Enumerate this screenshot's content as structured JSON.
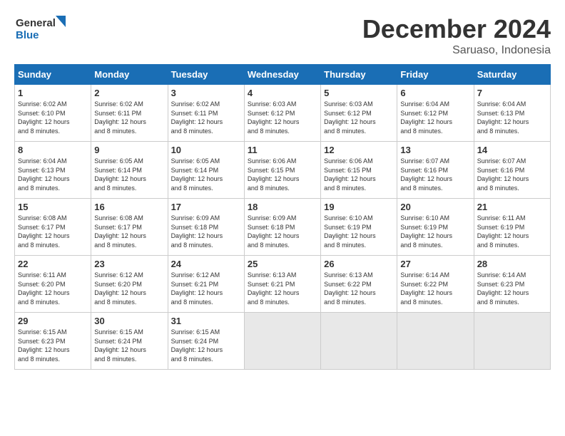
{
  "logo": {
    "line1": "General",
    "line2": "Blue"
  },
  "title": "December 2024",
  "subtitle": "Saruaso, Indonesia",
  "days_header": [
    "Sunday",
    "Monday",
    "Tuesday",
    "Wednesday",
    "Thursday",
    "Friday",
    "Saturday"
  ],
  "weeks": [
    [
      {
        "day": "1",
        "info": "Sunrise: 6:02 AM\nSunset: 6:10 PM\nDaylight: 12 hours\nand 8 minutes."
      },
      {
        "day": "2",
        "info": "Sunrise: 6:02 AM\nSunset: 6:11 PM\nDaylight: 12 hours\nand 8 minutes."
      },
      {
        "day": "3",
        "info": "Sunrise: 6:02 AM\nSunset: 6:11 PM\nDaylight: 12 hours\nand 8 minutes."
      },
      {
        "day": "4",
        "info": "Sunrise: 6:03 AM\nSunset: 6:12 PM\nDaylight: 12 hours\nand 8 minutes."
      },
      {
        "day": "5",
        "info": "Sunrise: 6:03 AM\nSunset: 6:12 PM\nDaylight: 12 hours\nand 8 minutes."
      },
      {
        "day": "6",
        "info": "Sunrise: 6:04 AM\nSunset: 6:12 PM\nDaylight: 12 hours\nand 8 minutes."
      },
      {
        "day": "7",
        "info": "Sunrise: 6:04 AM\nSunset: 6:13 PM\nDaylight: 12 hours\nand 8 minutes."
      }
    ],
    [
      {
        "day": "8",
        "info": "Sunrise: 6:04 AM\nSunset: 6:13 PM\nDaylight: 12 hours\nand 8 minutes."
      },
      {
        "day": "9",
        "info": "Sunrise: 6:05 AM\nSunset: 6:14 PM\nDaylight: 12 hours\nand 8 minutes."
      },
      {
        "day": "10",
        "info": "Sunrise: 6:05 AM\nSunset: 6:14 PM\nDaylight: 12 hours\nand 8 minutes."
      },
      {
        "day": "11",
        "info": "Sunrise: 6:06 AM\nSunset: 6:15 PM\nDaylight: 12 hours\nand 8 minutes."
      },
      {
        "day": "12",
        "info": "Sunrise: 6:06 AM\nSunset: 6:15 PM\nDaylight: 12 hours\nand 8 minutes."
      },
      {
        "day": "13",
        "info": "Sunrise: 6:07 AM\nSunset: 6:16 PM\nDaylight: 12 hours\nand 8 minutes."
      },
      {
        "day": "14",
        "info": "Sunrise: 6:07 AM\nSunset: 6:16 PM\nDaylight: 12 hours\nand 8 minutes."
      }
    ],
    [
      {
        "day": "15",
        "info": "Sunrise: 6:08 AM\nSunset: 6:17 PM\nDaylight: 12 hours\nand 8 minutes."
      },
      {
        "day": "16",
        "info": "Sunrise: 6:08 AM\nSunset: 6:17 PM\nDaylight: 12 hours\nand 8 minutes."
      },
      {
        "day": "17",
        "info": "Sunrise: 6:09 AM\nSunset: 6:18 PM\nDaylight: 12 hours\nand 8 minutes."
      },
      {
        "day": "18",
        "info": "Sunrise: 6:09 AM\nSunset: 6:18 PM\nDaylight: 12 hours\nand 8 minutes."
      },
      {
        "day": "19",
        "info": "Sunrise: 6:10 AM\nSunset: 6:19 PM\nDaylight: 12 hours\nand 8 minutes."
      },
      {
        "day": "20",
        "info": "Sunrise: 6:10 AM\nSunset: 6:19 PM\nDaylight: 12 hours\nand 8 minutes."
      },
      {
        "day": "21",
        "info": "Sunrise: 6:11 AM\nSunset: 6:19 PM\nDaylight: 12 hours\nand 8 minutes."
      }
    ],
    [
      {
        "day": "22",
        "info": "Sunrise: 6:11 AM\nSunset: 6:20 PM\nDaylight: 12 hours\nand 8 minutes."
      },
      {
        "day": "23",
        "info": "Sunrise: 6:12 AM\nSunset: 6:20 PM\nDaylight: 12 hours\nand 8 minutes."
      },
      {
        "day": "24",
        "info": "Sunrise: 6:12 AM\nSunset: 6:21 PM\nDaylight: 12 hours\nand 8 minutes."
      },
      {
        "day": "25",
        "info": "Sunrise: 6:13 AM\nSunset: 6:21 PM\nDaylight: 12 hours\nand 8 minutes."
      },
      {
        "day": "26",
        "info": "Sunrise: 6:13 AM\nSunset: 6:22 PM\nDaylight: 12 hours\nand 8 minutes."
      },
      {
        "day": "27",
        "info": "Sunrise: 6:14 AM\nSunset: 6:22 PM\nDaylight: 12 hours\nand 8 minutes."
      },
      {
        "day": "28",
        "info": "Sunrise: 6:14 AM\nSunset: 6:23 PM\nDaylight: 12 hours\nand 8 minutes."
      }
    ],
    [
      {
        "day": "29",
        "info": "Sunrise: 6:15 AM\nSunset: 6:23 PM\nDaylight: 12 hours\nand 8 minutes."
      },
      {
        "day": "30",
        "info": "Sunrise: 6:15 AM\nSunset: 6:24 PM\nDaylight: 12 hours\nand 8 minutes."
      },
      {
        "day": "31",
        "info": "Sunrise: 6:15 AM\nSunset: 6:24 PM\nDaylight: 12 hours\nand 8 minutes."
      },
      {
        "day": "",
        "info": ""
      },
      {
        "day": "",
        "info": ""
      },
      {
        "day": "",
        "info": ""
      },
      {
        "day": "",
        "info": ""
      }
    ]
  ]
}
